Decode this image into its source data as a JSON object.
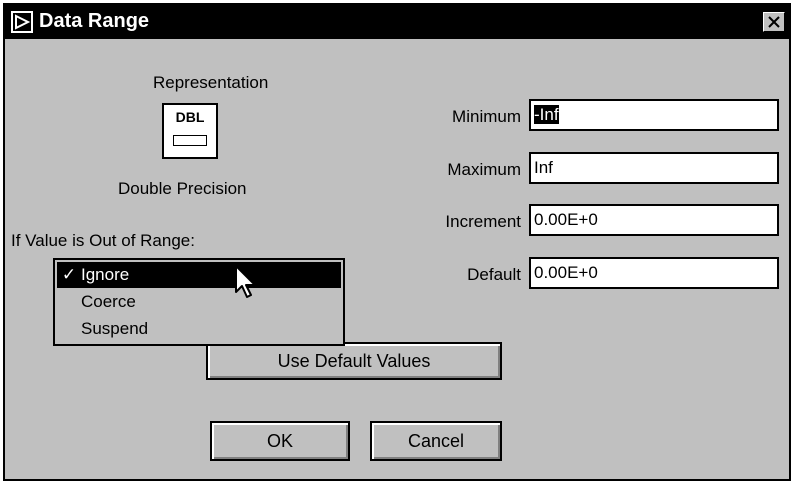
{
  "window": {
    "title": "Data Range"
  },
  "representation": {
    "heading": "Representation",
    "icon_label": "DBL",
    "type_name": "Double Precision"
  },
  "out_of_range": {
    "label": "If Value is Out of Range:",
    "options": [
      {
        "label": "Ignore",
        "checked": true
      },
      {
        "label": "Coerce",
        "checked": false
      },
      {
        "label": "Suspend",
        "checked": false
      }
    ]
  },
  "fields": {
    "minimum": {
      "label": "Minimum",
      "value": "-Inf"
    },
    "maximum": {
      "label": "Maximum",
      "value": "Inf"
    },
    "increment": {
      "label": "Increment",
      "value": "0.00E+0"
    },
    "default": {
      "label": "Default",
      "value": "0.00E+0"
    }
  },
  "buttons": {
    "use_default": "Use Default Values",
    "ok": "OK",
    "cancel": "Cancel"
  },
  "check_mark": "✓",
  "icons": {
    "app": "labview-arrow-icon",
    "close": "close-icon",
    "cursor": "mouse-pointer-icon"
  }
}
